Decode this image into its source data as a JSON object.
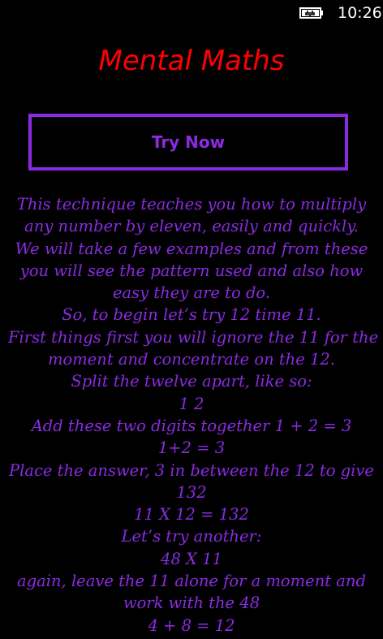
{
  "status_bar": {
    "time": "10:26",
    "battery_icon": "battery-charging-icon"
  },
  "app": {
    "title": "Mental Maths"
  },
  "button": {
    "label": "Try Now"
  },
  "colors": {
    "title": "#ff0000",
    "accent": "#8a2be2",
    "background": "#000000",
    "status_text": "#ffffff"
  },
  "body_lines": [
    "This technique teaches you how to multiply",
    "any number by eleven, easily and quickly.",
    "We will take a few examples and from these",
    "you will see the pattern used and also how",
    "easy they are to do.",
    "So, to begin let’s try 12 time 11.",
    "First things first you will ignore the 11 for the",
    "moment and concentrate on the 12.",
    "Split the twelve apart, like so:",
    "1 2",
    "Add these two digits together 1 + 2 = 3",
    "1+2 = 3",
    "Place the answer, 3 in between the 12 to give",
    "132",
    "11 X 12 = 132",
    "Let’s try another:",
    "48 X 11",
    "again, leave the 11 alone for a moment and",
    "work with the 48",
    "4 + 8 = 12"
  ]
}
